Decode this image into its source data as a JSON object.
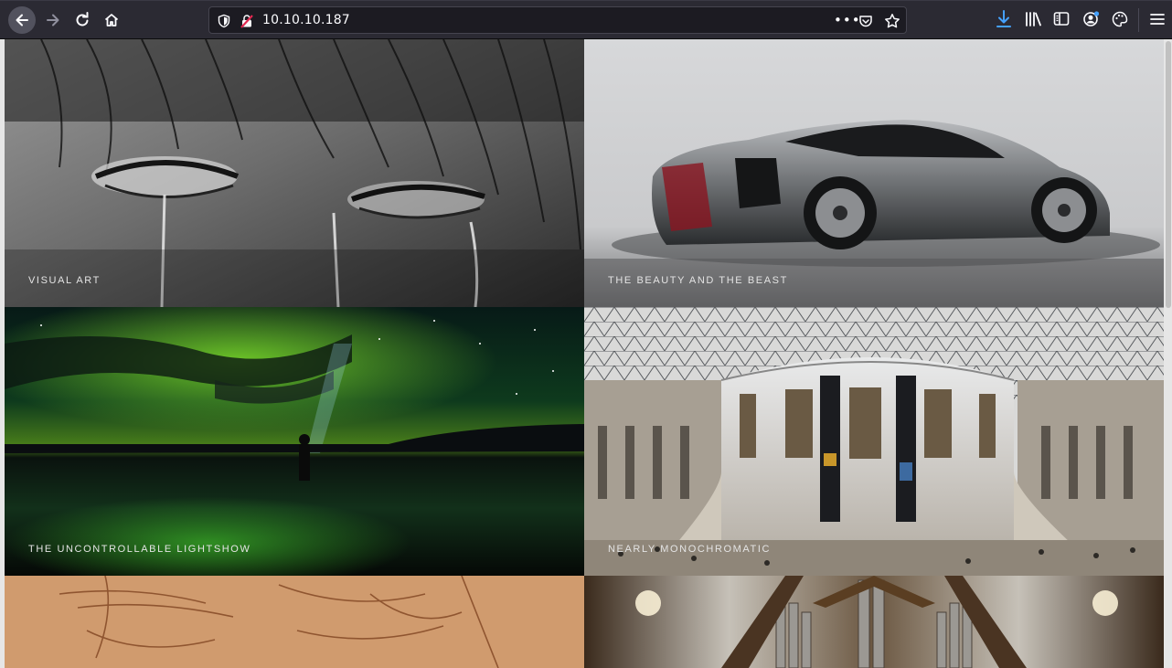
{
  "browser": {
    "url": "10.10.10.187",
    "colors": {
      "toolbar": "#2b2a33",
      "urlbar": "#1c1b22",
      "accent_download": "#45a1ff"
    }
  },
  "tiles": [
    {
      "caption": "VISUAL ART",
      "image": "crying-eye-sketch"
    },
    {
      "caption": "THE BEAUTY AND THE BEAST",
      "image": "silver-sports-car"
    },
    {
      "caption": "THE UNCONTROLLABLE LIGHTSHOW",
      "image": "aurora-night-sky"
    },
    {
      "caption": "NEARLY MONOCHROMATIC",
      "image": "museum-great-court"
    },
    {
      "caption": "",
      "image": "sepia-face-sketch"
    },
    {
      "caption": "",
      "image": "pipe-organ"
    }
  ]
}
